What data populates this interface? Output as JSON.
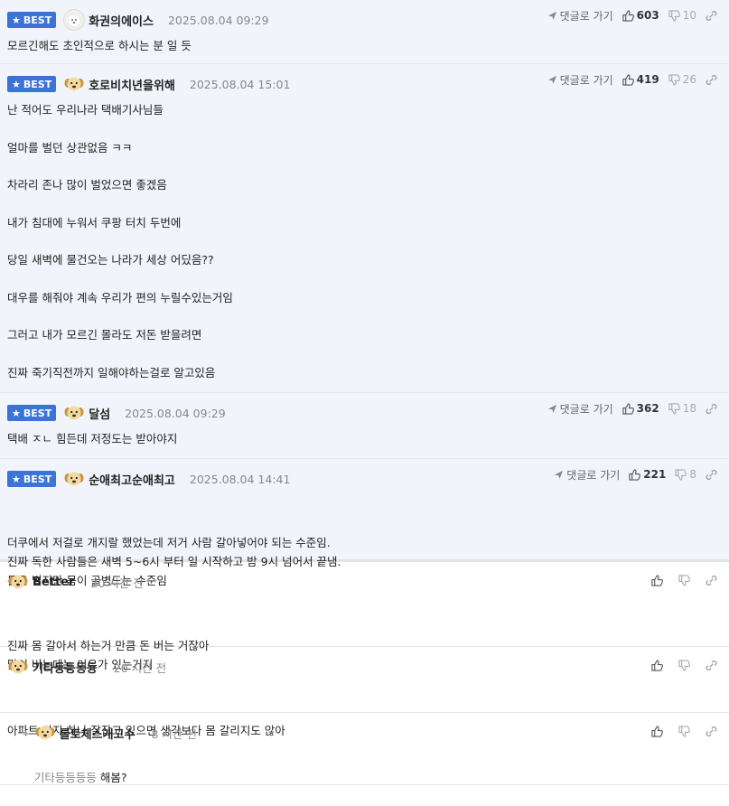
{
  "labels": {
    "best": "BEST",
    "goto_reply": "댓글로 가기"
  },
  "best_comments": [
    {
      "nick": "화권의에이스",
      "avatar": "white",
      "date": "2025.08.04 09:29",
      "up": "603",
      "down": "10",
      "lines": [
        "모르긴해도 초인적으로 하시는 분 일 듯"
      ]
    },
    {
      "nick": "호로비치년을위해",
      "avatar": "dog",
      "date": "2025.08.04 15:01",
      "up": "419",
      "down": "26",
      "lines": [
        "난 적어도 우리나라 택배기사님들",
        "",
        "얼마를 벌던 상관없음 ㅋㅋ",
        "",
        "차라리 존나 많이 벌었으면 좋겠음",
        "",
        "내가 침대에 누워서 쿠팡 터치 두번에",
        "",
        "당일 새벽에 물건오는 나라가 세상 어딨음??",
        "",
        "대우를 해줘야 계속 우리가 편의 누릴수있는거임",
        "",
        "그러고 내가 모르긴 몰라도 저돈 받을려면",
        "",
        "진짜 죽기직전까지 일해야하는걸로 알고있음"
      ]
    },
    {
      "nick": "달섬",
      "avatar": "dog",
      "date": "2025.08.04 09:29",
      "up": "362",
      "down": "18",
      "lines": [
        "택배 ㅈㄴ 힘든데 저정도는 받아야지"
      ]
    },
    {
      "nick": "순애최고순애최고",
      "avatar": "dog",
      "date": "2025.08.04 14:41",
      "up": "221",
      "down": "8",
      "lines": [
        "더쿠에서 저걸로 개지랄 했었는데 저거 사람 갈아넣어야 되는 수준임.",
        "진짜 독한 사람들은 새벽 5~6시 부터 일 시작하고 밤 9시 넘어서 끝냄.",
        "돈은 벌지만 몸이 골병드는 수준임"
      ]
    }
  ],
  "comments": [
    {
      "nick": "Better",
      "date": "20 시간 전",
      "lines": [
        "진짜 몸 갈아서 하는거 만큼 돈 버는 거잖아",
        "많이 버는데는 이유가 있는거지"
      ]
    },
    {
      "nick": "기타등등등등",
      "date": "20 시간 전",
      "lines": [
        "아파트 단지 하나 잘잡고 있으면 생각보다 몸 갈리지도 않아"
      ]
    }
  ],
  "reply": {
    "nick": "롤토체스개고수",
    "date": "8 시간 전",
    "target": "기타등등등등",
    "text": "해봄?"
  },
  "colors": {
    "best_bg": "#f1f4fa",
    "badge": "#3b73d9"
  }
}
